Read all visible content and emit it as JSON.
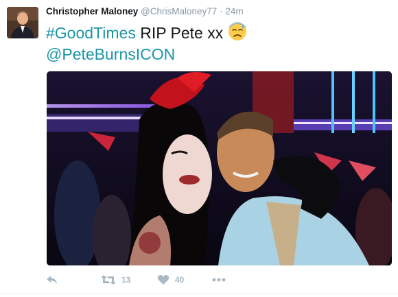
{
  "tweet": {
    "author_name": "Christopher Maloney",
    "author_handle": "@ChrisMaloney77",
    "separator": "·",
    "time": "24m",
    "hashtag": "#GoodTimes",
    "message": " RIP Pete xx ",
    "mention": "@PeteBurnsICON",
    "emoji": "sad-sweat-face-emoji"
  },
  "actions": {
    "reply_icon": "reply-icon",
    "retweet_icon": "retweet-icon",
    "retweet_count": "13",
    "like_icon": "heart-icon",
    "like_count": "40",
    "more_icon": "more-dots-icon"
  },
  "colors": {
    "link": "#1b95a8",
    "muted": "#8899a6",
    "action": "#aab8c2"
  }
}
